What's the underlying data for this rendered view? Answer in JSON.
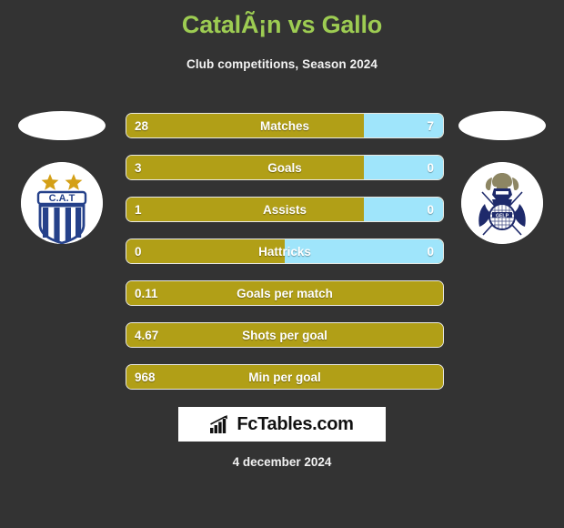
{
  "header": {
    "title": "CatalÃ¡n vs Gallo",
    "subtitle": "Club competitions, Season 2024",
    "title_color": "#9dcc52"
  },
  "theme": {
    "background": "#333333",
    "bar_left_color": "#b19f17",
    "bar_right_color": "#9fe5fb",
    "bar_border_color": "#e9e9e3",
    "text_color": "#ffffff"
  },
  "teams": {
    "home": {
      "crest_name": "talleres-de-cordoba-crest",
      "crest_text": "C.A.T"
    },
    "away": {
      "crest_name": "gimnasia-la-plata-crest",
      "crest_text": "GELP"
    }
  },
  "stats": [
    {
      "label": "Matches",
      "left": "28",
      "right": "7",
      "left_pct": 75,
      "has_right": true
    },
    {
      "label": "Goals",
      "left": "3",
      "right": "0",
      "left_pct": 75,
      "has_right": true
    },
    {
      "label": "Assists",
      "left": "1",
      "right": "0",
      "left_pct": 75,
      "has_right": true
    },
    {
      "label": "Hattricks",
      "left": "0",
      "right": "0",
      "left_pct": 50,
      "has_right": true
    },
    {
      "label": "Goals per match",
      "left": "0.11",
      "right": "",
      "left_pct": 100,
      "has_right": false
    },
    {
      "label": "Shots per goal",
      "left": "4.67",
      "right": "",
      "left_pct": 100,
      "has_right": false
    },
    {
      "label": "Min per goal",
      "left": "968",
      "right": "",
      "left_pct": 100,
      "has_right": false
    }
  ],
  "footer": {
    "brand_name": "FcTables.com",
    "brand_icon": "bar-chart-icon",
    "date": "4 december 2024"
  }
}
